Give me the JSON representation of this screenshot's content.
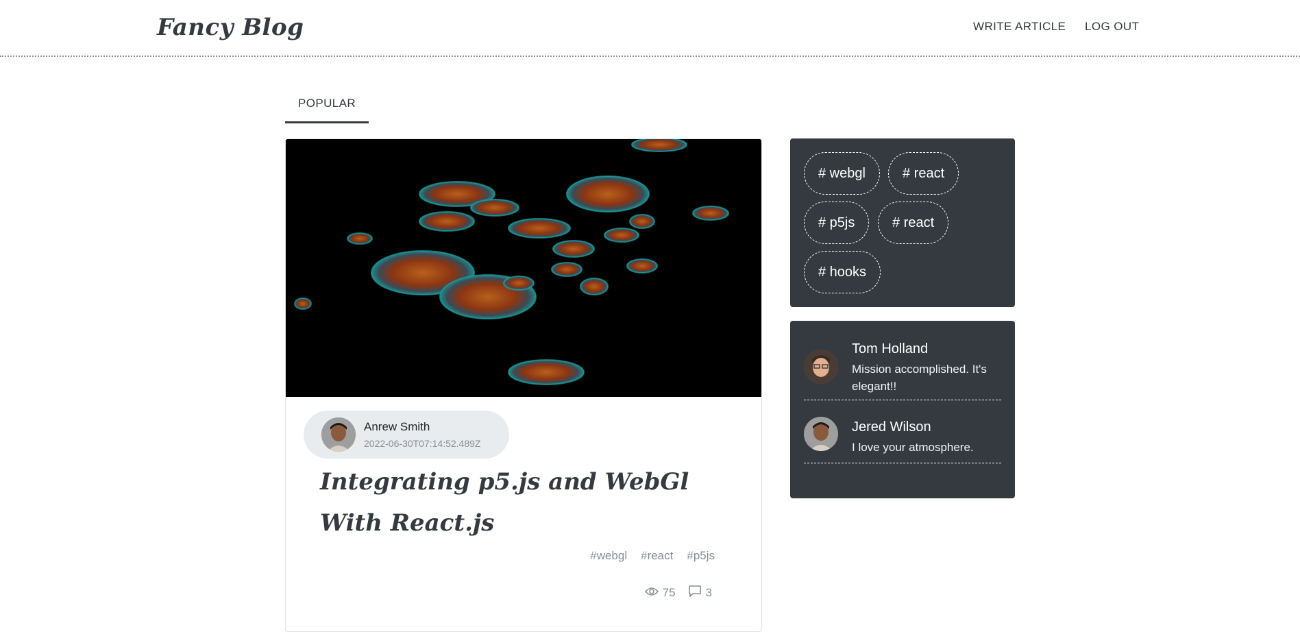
{
  "header": {
    "logo": "Fancy Blog",
    "nav": {
      "write": "WRITE ARTICLE",
      "logout": "LOG OUT"
    }
  },
  "tabs": [
    {
      "label": "POPULAR",
      "active": true
    }
  ],
  "article": {
    "author": {
      "name": "Anrew Smith",
      "date": "2022-06-30T07:14:52.489Z"
    },
    "title": "Integrating p5.js and WebGl With React.js",
    "tags": [
      "#webgl",
      "#react",
      "#p5js"
    ],
    "views": "75",
    "comments": "3"
  },
  "sidebar": {
    "tags": [
      "# webgl",
      "# react",
      "# p5js",
      "# react",
      "# hooks"
    ],
    "comments": [
      {
        "name": "Tom Holland",
        "text": "Mission accomplished. It's elegant!!"
      },
      {
        "name": "Jered Wilson",
        "text": "I love your atmosphere."
      }
    ]
  },
  "colors": {
    "accent": "#343a40",
    "muted": "#868e96",
    "pill": "#e9ecef"
  }
}
